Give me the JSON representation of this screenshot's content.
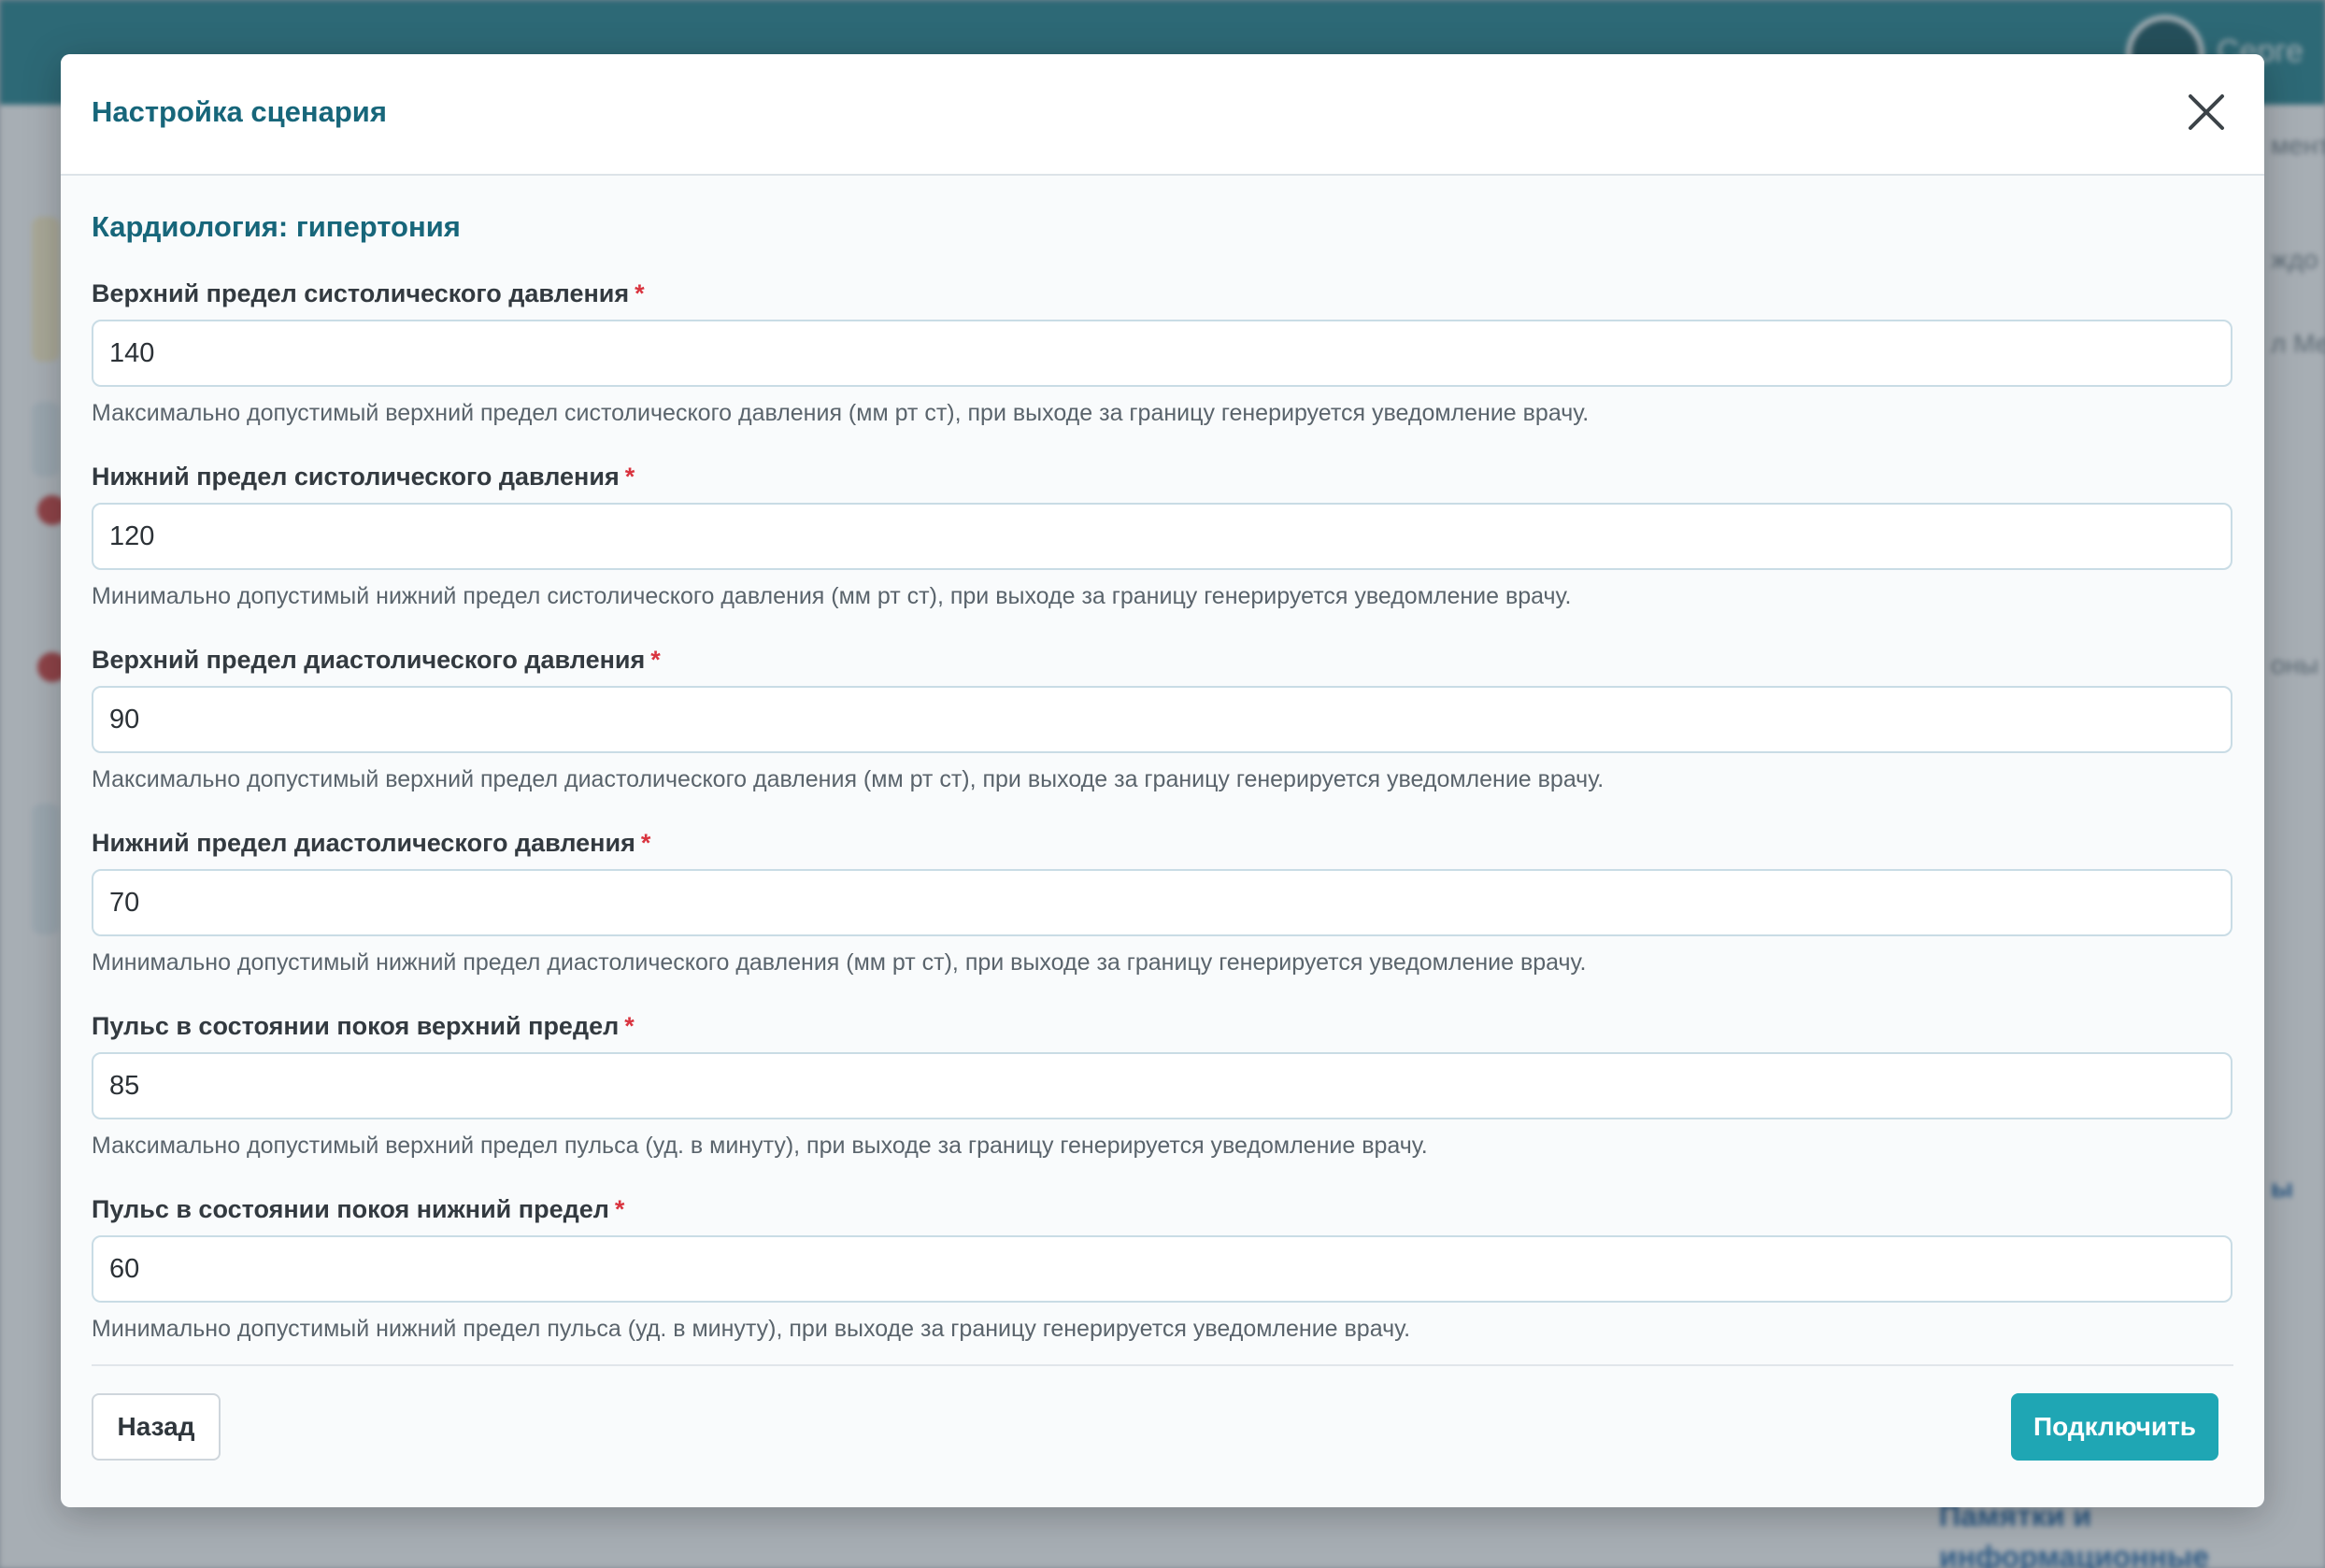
{
  "background": {
    "header_color": "#1d7a88",
    "username": "Серге",
    "right_texts": [
      "менты",
      "ждо",
      "л Ме",
      "оны",
      "ы"
    ],
    "bottom_link": "Памятки и информационные материалы"
  },
  "modal": {
    "title": "Настройка сценария",
    "section_title": "Кардиология: гипертония",
    "required_mark": "*",
    "fields": [
      {
        "label": "Верхний предел систолического давления",
        "value": "140",
        "hint": "Максимально допустимый верхний предел систолического давления (мм рт ст), при выходе за границу генерируется уведомление врачу."
      },
      {
        "label": "Нижний предел систолического давления",
        "value": "120",
        "hint": "Минимально допустимый нижний предел систолического давления (мм рт ст), при выходе за границу генерируется уведомление врачу."
      },
      {
        "label": "Верхний предел диастолического давления",
        "value": "90",
        "hint": "Максимально допустимый верхний предел диастолического давления (мм рт ст), при выходе за границу генерируется уведомление врачу."
      },
      {
        "label": "Нижний предел диастолического давления",
        "value": "70",
        "hint": "Минимально допустимый нижний предел диастолического давления (мм рт ст), при выходе за границу генерируется уведомление врачу."
      },
      {
        "label": "Пульс в состоянии покоя верхний предел",
        "value": "85",
        "hint": "Максимально допустимый верхний предел пульса (уд. в минуту), при выходе за границу генерируется уведомление врачу."
      },
      {
        "label": "Пульс в состоянии покоя нижний предел",
        "value": "60",
        "hint": "Минимально допустимый нижний предел пульса (уд. в минуту), при выходе за границу генерируется уведомление врачу."
      }
    ],
    "back_label": "Назад",
    "connect_label": "Подключить",
    "icons": {
      "close": "close-icon"
    },
    "colors": {
      "title": "#17667a",
      "required": "#d9343f",
      "primary_button": "#1fa6b4"
    }
  }
}
